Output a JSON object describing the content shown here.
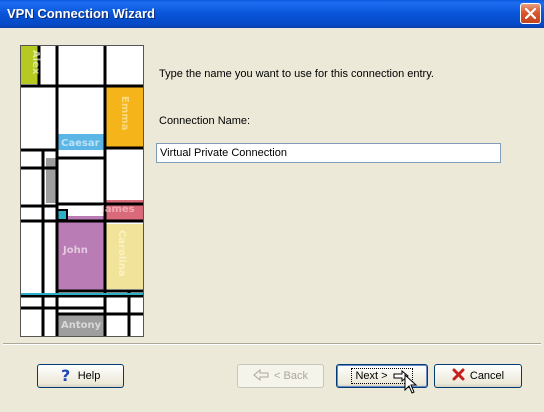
{
  "window": {
    "title": "VPN Connection Wizard",
    "colors": {
      "title_bar": "#0854d8",
      "close_button": "#d8582e",
      "face": "#ece9d8"
    }
  },
  "side_art": {
    "names": [
      "Alex",
      "Emma",
      "Caesar",
      "James",
      "John",
      "Carolina",
      "Antony"
    ],
    "colors": {
      "alex": "#b5c920",
      "emma": "#f5b41a",
      "caesar": "#5bb6e6",
      "james": "#d96a7a",
      "john": "#b97cb4",
      "carolina": "#f2e39a",
      "antony": "#9e9e9e",
      "accent_line": "#2bb0c8"
    }
  },
  "content": {
    "prompt": "Type the name you want to use for this connection entry.",
    "field_label": "Connection Name:",
    "field_value": "Virtual Private Connection"
  },
  "buttons": {
    "help": "Help",
    "back": "< Back",
    "next": "Next >",
    "cancel": "Cancel"
  },
  "icons": {
    "help": "question-mark-icon",
    "back": "back-arrow-icon",
    "next": "forward-arrow-icon",
    "cancel": "red-x-icon",
    "close": "close-icon",
    "cursor": "mouse-pointer-icon"
  }
}
